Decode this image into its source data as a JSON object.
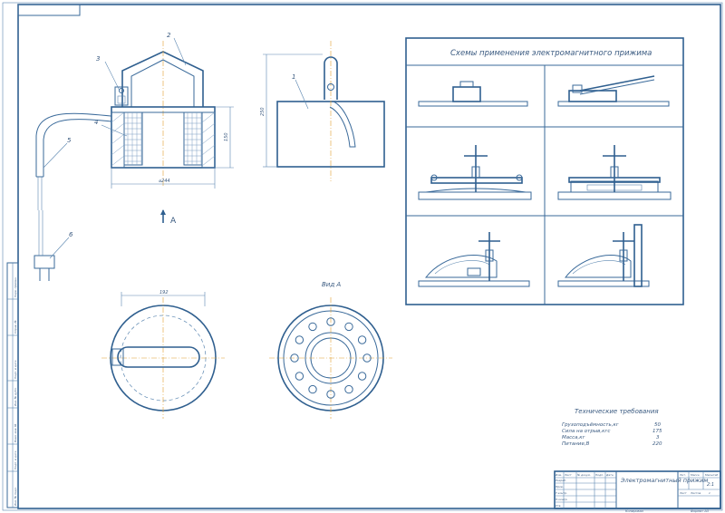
{
  "schemes": {
    "title": "Схемы применения электромагнитного прижима"
  },
  "view_label": "Вид А",
  "arrow_label": "A",
  "dims": {
    "d244": "⌀244",
    "d192": "192",
    "h150": "150",
    "h250": "250"
  },
  "leaders": [
    "1",
    "2",
    "3",
    "4",
    "5",
    "6"
  ],
  "tech": {
    "title": "Технические требования",
    "rows": [
      {
        "label": "Грузоподъёмность,кг",
        "value": "50"
      },
      {
        "label": "Сила на отрыв,кгс",
        "value": "175"
      },
      {
        "label": "Масса,кг",
        "value": "3"
      },
      {
        "label": "Питание,В",
        "value": "220"
      }
    ]
  },
  "stamp": {
    "name": "Электромагнитный прижим",
    "mass_head": "Лит.",
    "weight_head": "Масса",
    "scale_head": "Масштаб",
    "scale": "2:1",
    "sheet": "Лист",
    "sheets": "Листов",
    "sheets_count": "1",
    "row_labels": [
      "Изм.",
      "Лист",
      "№ докум.",
      "Подп.",
      "Дата",
      "Разраб.",
      "Пров.",
      "Т.контр.",
      "Н.контр.",
      "Утв."
    ],
    "bottom_left": "Копировал",
    "bottom_right": "Формат А3"
  },
  "left_strip": [
    "Перв. примен.",
    "Справ. №",
    "Подп. и дата",
    "Инв. № дубл.",
    "Взам. инв. №",
    "Подп. и дата",
    "Инв. № подл."
  ]
}
